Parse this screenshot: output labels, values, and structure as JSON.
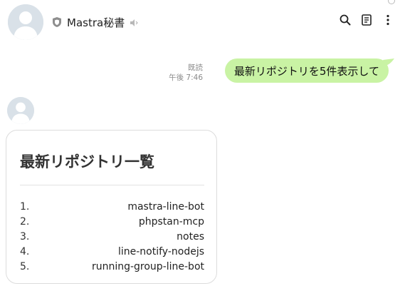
{
  "header": {
    "title": "Mastra秘書",
    "icons": [
      "shield-icon",
      "speaker-muted-icon",
      "search-icon",
      "note-icon",
      "more-vertical-icon"
    ]
  },
  "sent_message": {
    "read_label": "既読",
    "time": "午後 7:46",
    "text": "最新リポジトリを5件表示して",
    "bubble_color": "#c9f3a4"
  },
  "received_card": {
    "title": "最新リポジトリ一覧",
    "items": [
      {
        "num": "1.",
        "name": "mastra-line-bot"
      },
      {
        "num": "2.",
        "name": "phpstan-mcp"
      },
      {
        "num": "3.",
        "name": "notes"
      },
      {
        "num": "4.",
        "name": "line-notify-nodejs"
      },
      {
        "num": "5.",
        "name": "running-group-line-bot"
      }
    ]
  }
}
